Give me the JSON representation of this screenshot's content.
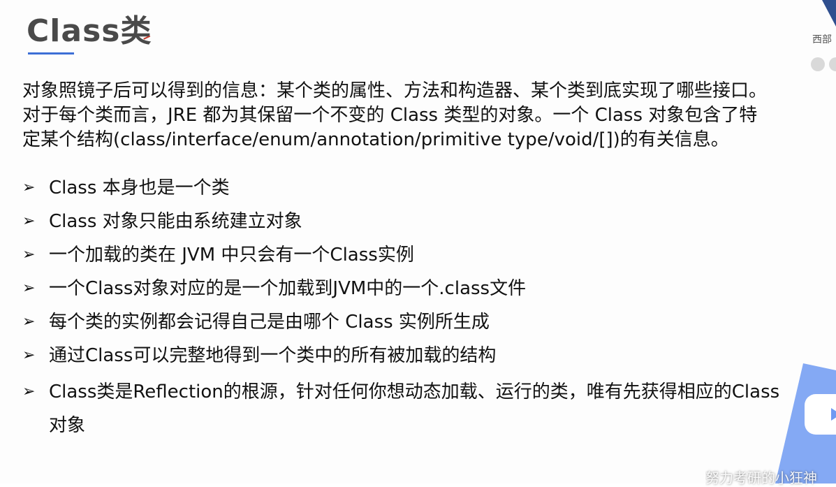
{
  "title": "Class类",
  "intro": {
    "line1": "对象照镜子后可以得到的信息：某个类的属性、方法和构造器、某个类到底实现了哪些接口。",
    "line2": "对于每个类而言，JRE 都为其保留一个不变的 Class 类型的对象。一个 Class 对象包含了特",
    "line3": "定某个结构(class/interface/enum/annotation/primitive type/void/[])的有关信息。"
  },
  "bullet_marker": "➢",
  "bullets": [
    "Class 本身也是一个类",
    "Class 对象只能由系统建立对象",
    "一个加载的类在 JVM 中只会有一个Class实例",
    "一个Class对象对应的是一个加载到JVM中的一个.class文件",
    "每个类的实例都会记得自己是由哪个 Class 实例所生成",
    "通过Class可以完整地得到一个类中的所有被加载的结构",
    "Class类是Reflection的根源，针对任何你想动态加载、运行的类，唯有先获得相应的Class对象"
  ],
  "corner_label": "西部",
  "watermark": "努力考研的小狂神",
  "colors": {
    "accent": "#3d6fd6",
    "title": "#4a4a4a",
    "text": "#111111",
    "deco_blue": "#5b8ef0"
  },
  "icons": [
    "bullet-arrow-icon",
    "play-icon",
    "corner-triangle-icon",
    "dot-icon"
  ]
}
